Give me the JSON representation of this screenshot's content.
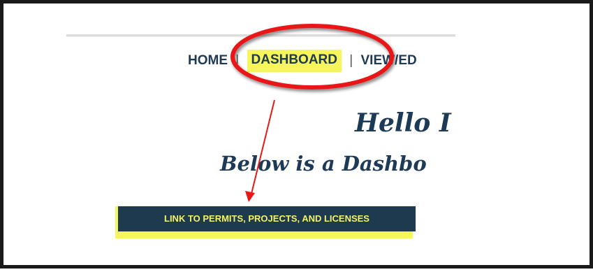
{
  "nav": {
    "items": [
      {
        "label": "HOME"
      },
      {
        "label": "DASHBOARD"
      },
      {
        "label": "VIEW/ED"
      }
    ],
    "separator": "|"
  },
  "main": {
    "greeting": "Hello I",
    "subtitle": "Below is a Dashbo"
  },
  "link_button": {
    "label": "LINK TO PERMITS, PROJECTS, AND LICENSES"
  },
  "colors": {
    "highlight": "#f6f65a",
    "nav_text": "#203a55",
    "annotation": "#e81818",
    "button_bg": "#1d3a4e",
    "button_text": "#f4f26a"
  }
}
